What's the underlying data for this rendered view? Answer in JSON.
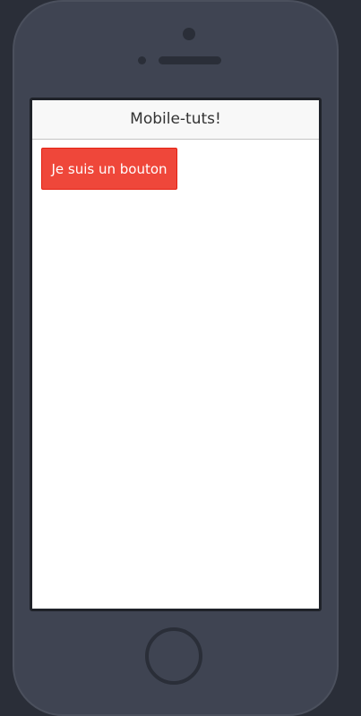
{
  "app": {
    "header": {
      "title": "Mobile-tuts!"
    },
    "main": {
      "button_label": "Je suis un bouton"
    }
  },
  "colors": {
    "device_background": "#2a2e38",
    "device_body": "#3f4452",
    "header_background": "#f8f8f8",
    "button_background": "#ef473a",
    "button_text": "#ffffff"
  }
}
